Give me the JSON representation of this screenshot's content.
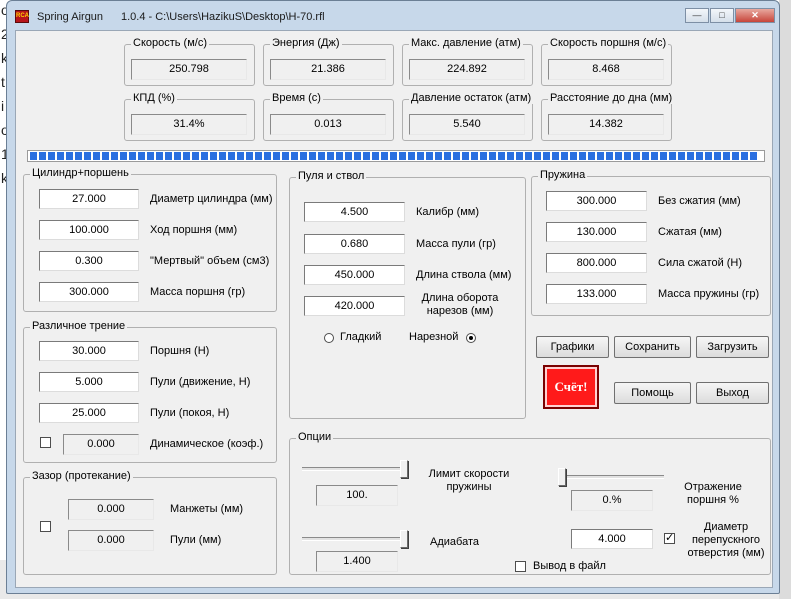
{
  "window": {
    "app_name": "Spring Airgun",
    "version_path": "1.0.4 - C:\\Users\\HazikuS\\Desktop\\H-70.rfl",
    "icon_text": "RCA"
  },
  "background": {
    "left_chars": [
      "o",
      "2",
      "k",
      "t",
      "i",
      "o",
      "1",
      "k"
    ]
  },
  "results": [
    {
      "label": "Скорость (м/с)",
      "value": "250.798"
    },
    {
      "label": "Энергия (Дж)",
      "value": "21.386"
    },
    {
      "label": "Макс. давление (атм)",
      "value": "224.892"
    },
    {
      "label": "Скорость поршня (м/с)",
      "value": "8.468"
    },
    {
      "label": "КПД (%)",
      "value": "31.4%"
    },
    {
      "label": "Время (с)",
      "value": "0.013"
    },
    {
      "label": "Давление остаток (атм)",
      "value": "5.540"
    },
    {
      "label": "Расстояние до дна (мм)",
      "value": "14.382"
    }
  ],
  "progress": {
    "fraction": 1.0
  },
  "cylinder": {
    "title": "Цилиндр+поршень",
    "rows": [
      {
        "value": "27.000",
        "label": "Диаметр цилиндра (мм)"
      },
      {
        "value": "100.000",
        "label": "Ход поршня (мм)"
      },
      {
        "value": "0.300",
        "label": "\"Мертвый\" объем (см3)"
      },
      {
        "value": "300.000",
        "label": "Масса поршня (гр)"
      }
    ]
  },
  "friction": {
    "title": "Различное трение",
    "rows": [
      {
        "value": "30.000",
        "label": "Поршня (Н)"
      },
      {
        "value": "5.000",
        "label": "Пули (движение, Н)"
      },
      {
        "value": "25.000",
        "label": "Пули (покоя, Н)"
      }
    ],
    "dynamic": {
      "value": "0.000",
      "label": "Динамическое (коэф.)",
      "checked": false
    }
  },
  "gap": {
    "title": "Зазор (протекание)",
    "checked": false,
    "rows": [
      {
        "value": "0.000",
        "label": "Манжеты (мм)"
      },
      {
        "value": "0.000",
        "label": "Пули (мм)"
      }
    ]
  },
  "barrel": {
    "title": "Пуля и ствол",
    "rows": [
      {
        "value": "4.500",
        "label": "Калибр (мм)"
      },
      {
        "value": "0.680",
        "label": "Масса пули (гр)"
      },
      {
        "value": "450.000",
        "label": "Длина ствола (мм)"
      },
      {
        "value": "420.000",
        "label": "Длина оборота нарезов (мм)"
      }
    ],
    "smooth_label": "Гладкий",
    "rifled_label": "Нарезной",
    "selected": "rifled"
  },
  "spring": {
    "title": "Пружина",
    "rows": [
      {
        "value": "300.000",
        "label": "Без  сжатия (мм)"
      },
      {
        "value": "130.000",
        "label": "Сжатая (мм)"
      },
      {
        "value": "800.000",
        "label": "Сила сжатой (Н)"
      },
      {
        "value": "133.000",
        "label": "Масса пружины (гр)"
      }
    ]
  },
  "buttons": {
    "graphs": "Графики",
    "save": "Сохранить",
    "load": "Загрузить",
    "calc": "Счёт!",
    "help": "Помощь",
    "exit": "Выход"
  },
  "options": {
    "title": "Опции",
    "spring_speed_limit": {
      "label": "Лимит скорости пружины",
      "value": "100.",
      "slider_fraction": 1.0
    },
    "adiabatic": {
      "label": "Адиабата",
      "value": "1.400",
      "slider_fraction": 1.0
    },
    "piston_bounce": {
      "label": "Отражение поршня %",
      "value": "0.%",
      "slider_fraction": 0.0
    },
    "port_diameter": {
      "label": "Диаметр перепускного отверстия (мм)",
      "value": "4.000",
      "checked": true
    },
    "file_output": {
      "label": "Вывод в файл",
      "checked": false
    }
  }
}
